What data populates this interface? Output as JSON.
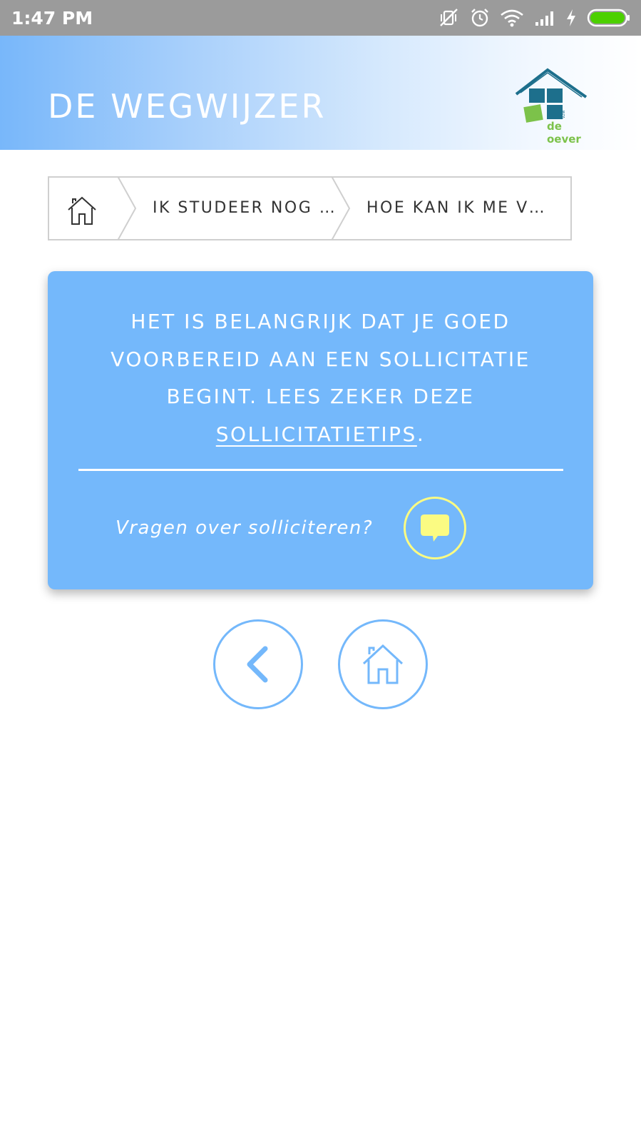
{
  "status_bar": {
    "time": "1:47 PM",
    "icons": [
      "vibrate-off-icon",
      "alarm-icon",
      "wifi-icon",
      "signal-icon",
      "charging-icon",
      "battery-icon"
    ]
  },
  "header": {
    "title": "DE WEGWIJZER",
    "logo_text": "de oever",
    "logo_small_text": "vzw"
  },
  "breadcrumb": {
    "home_icon": "home-icon",
    "items": [
      {
        "label": "IK STUDEER NOG …"
      },
      {
        "label": "HOE KAN IK ME V…"
      }
    ]
  },
  "card": {
    "message_before_link": "HET IS BELANGRIJK DAT JE GOED VOORBEREID AAN EEN SOLLICITATIE BEGINT. LEES ZEKER DEZE ",
    "link_text": "SOLLICITATIETIPS",
    "message_after_link": ".",
    "question": "Vragen over solliciteren?",
    "chat_icon": "chat-bubble-icon"
  },
  "nav": {
    "back_icon": "chevron-left-icon",
    "home_icon": "home-icon"
  },
  "colors": {
    "accent": "#74b8fb",
    "chat_yellow": "#fbfb82",
    "status_bar": "#9b9b9b",
    "logo_teal": "#1d6f8c",
    "logo_green": "#7cc24a",
    "battery_green": "#4cd000"
  }
}
